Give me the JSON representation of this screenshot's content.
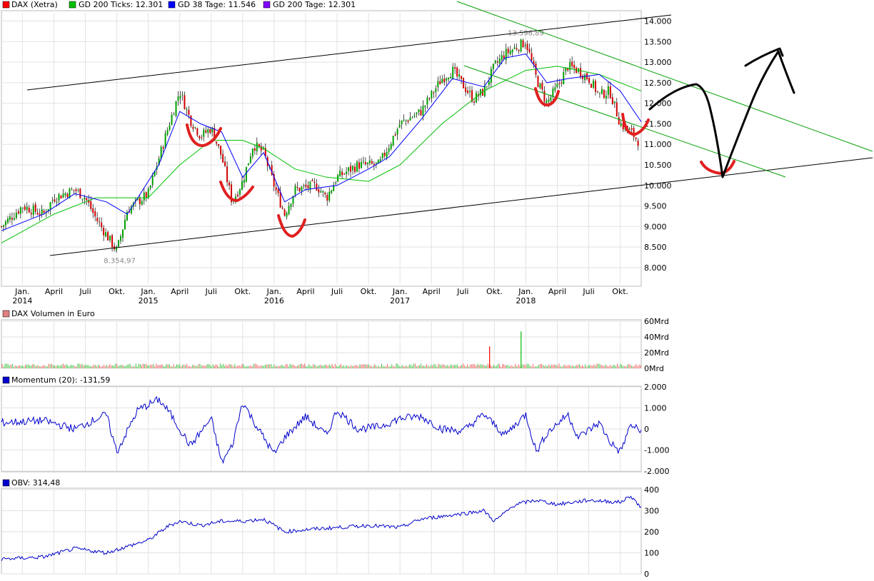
{
  "legend": [
    {
      "swatch_color": "#ff0000",
      "label": "DAX (Xetra)"
    },
    {
      "swatch_color": "#00c000",
      "label": "GD 200 Ticks: 12.301"
    },
    {
      "swatch_color": "#0000ff",
      "label": "GD 38 Tage: 11.546"
    },
    {
      "swatch_color": "#8000ff",
      "label": "GD 200 Tage: 12.301"
    }
  ],
  "chart_data": [
    {
      "type": "candlestick",
      "title": "DAX (Xetra)",
      "ylim": [
        7600,
        14200
      ],
      "y_ticks": [
        8000,
        8500,
        9000,
        9500,
        10000,
        10500,
        11000,
        11500,
        12000,
        12500,
        13000,
        13500,
        14000
      ],
      "y_tick_labels": [
        "8.000",
        "8.500",
        "9.000",
        "9.500",
        "10.000",
        "10.500",
        "11.000",
        "11.500",
        "12.000",
        "12.500",
        "13.000",
        "13.500",
        "14.000"
      ],
      "x_range": [
        "2013-11",
        "2018-12"
      ],
      "x_ticks": [
        {
          "date": "2014-01",
          "label": "Jan.",
          "year": "2014"
        },
        {
          "date": "2014-04",
          "label": "April",
          "year": ""
        },
        {
          "date": "2014-07",
          "label": "Juli",
          "year": ""
        },
        {
          "date": "2014-10",
          "label": "Okt.",
          "year": ""
        },
        {
          "date": "2015-01",
          "label": "Jan.",
          "year": "2015"
        },
        {
          "date": "2015-04",
          "label": "April",
          "year": ""
        },
        {
          "date": "2015-07",
          "label": "Juli",
          "year": ""
        },
        {
          "date": "2015-10",
          "label": "Okt.",
          "year": ""
        },
        {
          "date": "2016-01",
          "label": "Jan.",
          "year": "2016"
        },
        {
          "date": "2016-04",
          "label": "April",
          "year": ""
        },
        {
          "date": "2016-07",
          "label": "Juli",
          "year": ""
        },
        {
          "date": "2016-10",
          "label": "Okt.",
          "year": ""
        },
        {
          "date": "2017-01",
          "label": "Jan.",
          "year": "2017"
        },
        {
          "date": "2017-04",
          "label": "April",
          "year": ""
        },
        {
          "date": "2017-07",
          "label": "Juli",
          "year": ""
        },
        {
          "date": "2017-10",
          "label": "Okt.",
          "year": ""
        },
        {
          "date": "2018-01",
          "label": "Jan.",
          "year": "2018"
        },
        {
          "date": "2018-04",
          "label": "April",
          "year": ""
        },
        {
          "date": "2018-07",
          "label": "Juli",
          "year": ""
        },
        {
          "date": "2018-10",
          "label": "Okt.",
          "year": ""
        }
      ],
      "price_series": {
        "name": "DAX (Xetra)",
        "color": "#000000",
        "x": [
          "2013-11",
          "2014-01",
          "2014-03",
          "2014-04",
          "2014-06",
          "2014-07",
          "2014-08",
          "2014-10",
          "2014-11",
          "2015-01",
          "2015-03",
          "2015-04",
          "2015-05",
          "2015-06",
          "2015-07",
          "2015-08",
          "2015-09",
          "2015-10",
          "2015-11",
          "2015-12",
          "2016-01",
          "2016-02",
          "2016-03",
          "2016-05",
          "2016-06",
          "2016-07",
          "2016-09",
          "2016-11",
          "2016-12",
          "2017-01",
          "2017-03",
          "2017-05",
          "2017-06",
          "2017-08",
          "2017-09",
          "2017-10",
          "2017-11",
          "2018-01",
          "2018-02",
          "2018-03",
          "2018-04",
          "2018-05",
          "2018-06",
          "2018-07",
          "2018-08",
          "2018-09",
          "2018-10",
          "2018-11",
          "2018-12"
        ],
        "y": [
          9000,
          9500,
          9300,
          9700,
          9900,
          9700,
          9200,
          8400,
          9400,
          9800,
          11500,
          12300,
          11600,
          11200,
          11400,
          10700,
          9600,
          10100,
          11000,
          10800,
          10000,
          9300,
          9900,
          10000,
          9700,
          10200,
          10500,
          10500,
          11000,
          11500,
          11800,
          12600,
          12800,
          12100,
          12300,
          12900,
          13200,
          13500,
          12600,
          12000,
          12400,
          12900,
          12800,
          12600,
          12200,
          12300,
          11500,
          11300,
          11000
        ]
      },
      "lines": [
        {
          "name": "GD 200 Ticks",
          "color": "#00c000",
          "x": [
            "2013-11",
            "2014-04",
            "2014-08",
            "2015-01",
            "2015-04",
            "2015-07",
            "2015-10",
            "2015-12",
            "2016-03",
            "2016-06",
            "2016-10",
            "2017-01",
            "2017-05",
            "2017-09",
            "2018-01",
            "2018-04",
            "2018-08",
            "2018-12"
          ],
          "y": [
            8600,
            9300,
            9700,
            9700,
            10500,
            11100,
            11100,
            10900,
            10400,
            10200,
            10100,
            10500,
            11500,
            12300,
            12800,
            12900,
            12700,
            12300
          ]
        },
        {
          "name": "GD 38 Tage",
          "color": "#0000ff",
          "x": [
            "2013-11",
            "2014-03",
            "2014-06",
            "2014-09",
            "2014-11",
            "2015-02",
            "2015-04",
            "2015-06",
            "2015-08",
            "2015-10",
            "2015-12",
            "2016-02",
            "2016-04",
            "2016-07",
            "2016-10",
            "2016-12",
            "2017-03",
            "2017-06",
            "2017-09",
            "2017-11",
            "2018-01",
            "2018-03",
            "2018-05",
            "2018-08",
            "2018-10",
            "2018-12"
          ],
          "y": [
            8900,
            9300,
            9800,
            9600,
            9300,
            10500,
            11800,
            11500,
            11300,
            10200,
            10800,
            9600,
            9900,
            10000,
            10400,
            10700,
            11600,
            12600,
            12400,
            13100,
            13200,
            12500,
            12600,
            12700,
            12300,
            11550
          ]
        }
      ],
      "annotations": [
        {
          "text": "8.354,97",
          "x": "2014-10",
          "y": 8355
        },
        {
          "text": "13.596,89",
          "x": "2018-01",
          "y": 13597
        }
      ]
    },
    {
      "type": "bar",
      "title": "DAX Volumen in Euro",
      "ylim": [
        0,
        60
      ],
      "y_tick_labels": [
        "60Mrd",
        "40Mrd",
        "20Mrd",
        "0Mrd"
      ],
      "spikes": [
        {
          "x": "2017-09",
          "value": 28,
          "color": "#ff0000"
        },
        {
          "x": "2017-12",
          "value": 47,
          "color": "#00c000"
        }
      ],
      "typical_value_mrd": 4
    },
    {
      "type": "line",
      "title": "Momentum (20): -131,59",
      "ylim": [
        -2000,
        2000
      ],
      "y_ticks": [
        2000,
        1000,
        0,
        -1000,
        -2000
      ],
      "y_tick_labels": [
        "2.000",
        "1.000",
        "0",
        "-1.000",
        "-2.000"
      ],
      "series": [
        {
          "name": "Momentum (20)",
          "color": "#0000cc",
          "x": [
            "2013-11",
            "2014-03",
            "2014-06",
            "2014-09",
            "2014-10",
            "2014-12",
            "2015-02",
            "2015-03",
            "2015-05",
            "2015-07",
            "2015-08",
            "2015-09",
            "2015-10",
            "2015-11",
            "2016-01",
            "2016-02",
            "2016-04",
            "2016-06",
            "2016-07",
            "2016-09",
            "2016-11",
            "2017-01",
            "2017-03",
            "2017-05",
            "2017-07",
            "2017-09",
            "2017-11",
            "2018-01",
            "2018-02",
            "2018-03",
            "2018-05",
            "2018-06",
            "2018-08",
            "2018-09",
            "2018-10",
            "2018-11",
            "2018-12"
          ],
          "y": [
            300,
            400,
            0,
            700,
            -1100,
            900,
            1400,
            800,
            -800,
            500,
            -1600,
            -800,
            1300,
            400,
            -1200,
            -400,
            600,
            -300,
            900,
            0,
            100,
            500,
            600,
            0,
            -100,
            700,
            -300,
            700,
            -1100,
            -200,
            700,
            -400,
            300,
            -600,
            -1100,
            200,
            -130
          ]
        }
      ]
    },
    {
      "type": "line",
      "title": "OBV: 314,48",
      "ylim": [
        0,
        400
      ],
      "y_ticks": [
        400,
        300,
        200,
        100,
        0
      ],
      "y_tick_labels": [
        "400",
        "300",
        "200",
        "100",
        "0"
      ],
      "series": [
        {
          "name": "OBV",
          "color": "#0000cc",
          "x": [
            "2013-11",
            "2014-03",
            "2014-06",
            "2014-09",
            "2014-11",
            "2015-01",
            "2015-03",
            "2015-04",
            "2015-06",
            "2015-08",
            "2015-10",
            "2015-12",
            "2016-01",
            "2016-02",
            "2016-04",
            "2016-07",
            "2016-10",
            "2017-01",
            "2017-03",
            "2017-06",
            "2017-09",
            "2017-10",
            "2017-12",
            "2018-02",
            "2018-04",
            "2018-07",
            "2018-10",
            "2018-11",
            "2018-12"
          ],
          "y": [
            70,
            80,
            120,
            100,
            130,
            160,
            230,
            250,
            230,
            250,
            250,
            260,
            230,
            200,
            210,
            220,
            230,
            220,
            260,
            280,
            300,
            250,
            330,
            350,
            330,
            350,
            340,
            370,
            314
          ]
        }
      ]
    }
  ]
}
